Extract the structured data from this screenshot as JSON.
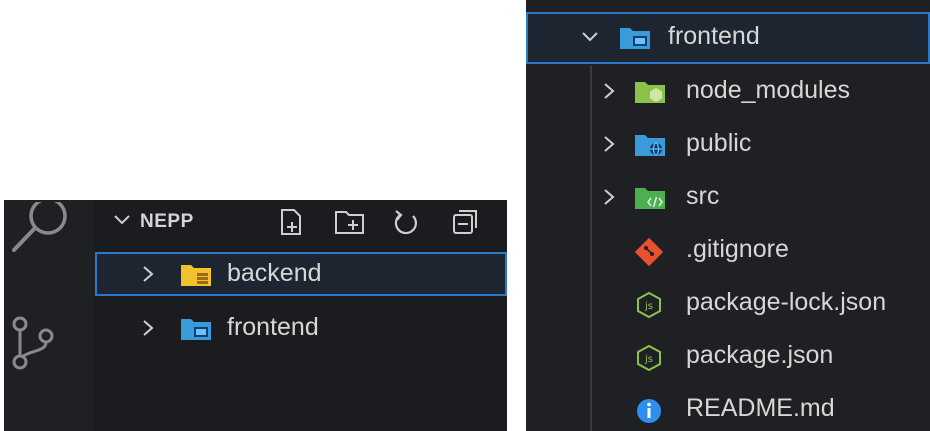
{
  "left_panel": {
    "workspace_title": "NEPP",
    "items": [
      {
        "label": "backend",
        "icon": "folder-backend-icon",
        "selected": true
      },
      {
        "label": "frontend",
        "icon": "folder-frontend-icon",
        "selected": false
      }
    ],
    "header_actions": [
      "new-file-icon",
      "new-folder-icon",
      "refresh-icon",
      "collapse-all-icon"
    ]
  },
  "right_panel": {
    "root": {
      "label": "frontend",
      "icon": "folder-frontend-open-icon"
    },
    "items": [
      {
        "label": "node_modules",
        "type": "folder",
        "icon": "folder-node-icon"
      },
      {
        "label": "public",
        "type": "folder",
        "icon": "folder-public-icon"
      },
      {
        "label": "src",
        "type": "folder",
        "icon": "folder-src-icon"
      },
      {
        "label": ".gitignore",
        "type": "file",
        "icon": "git-icon"
      },
      {
        "label": "package-lock.json",
        "type": "file",
        "icon": "nodejs-icon"
      },
      {
        "label": "package.json",
        "type": "file",
        "icon": "nodejs-icon"
      },
      {
        "label": "README.md",
        "type": "file",
        "icon": "info-icon"
      }
    ]
  },
  "colors": {
    "accent": "#2b7ac9",
    "background": "#1e1f22",
    "text": "#d7d7d7"
  }
}
